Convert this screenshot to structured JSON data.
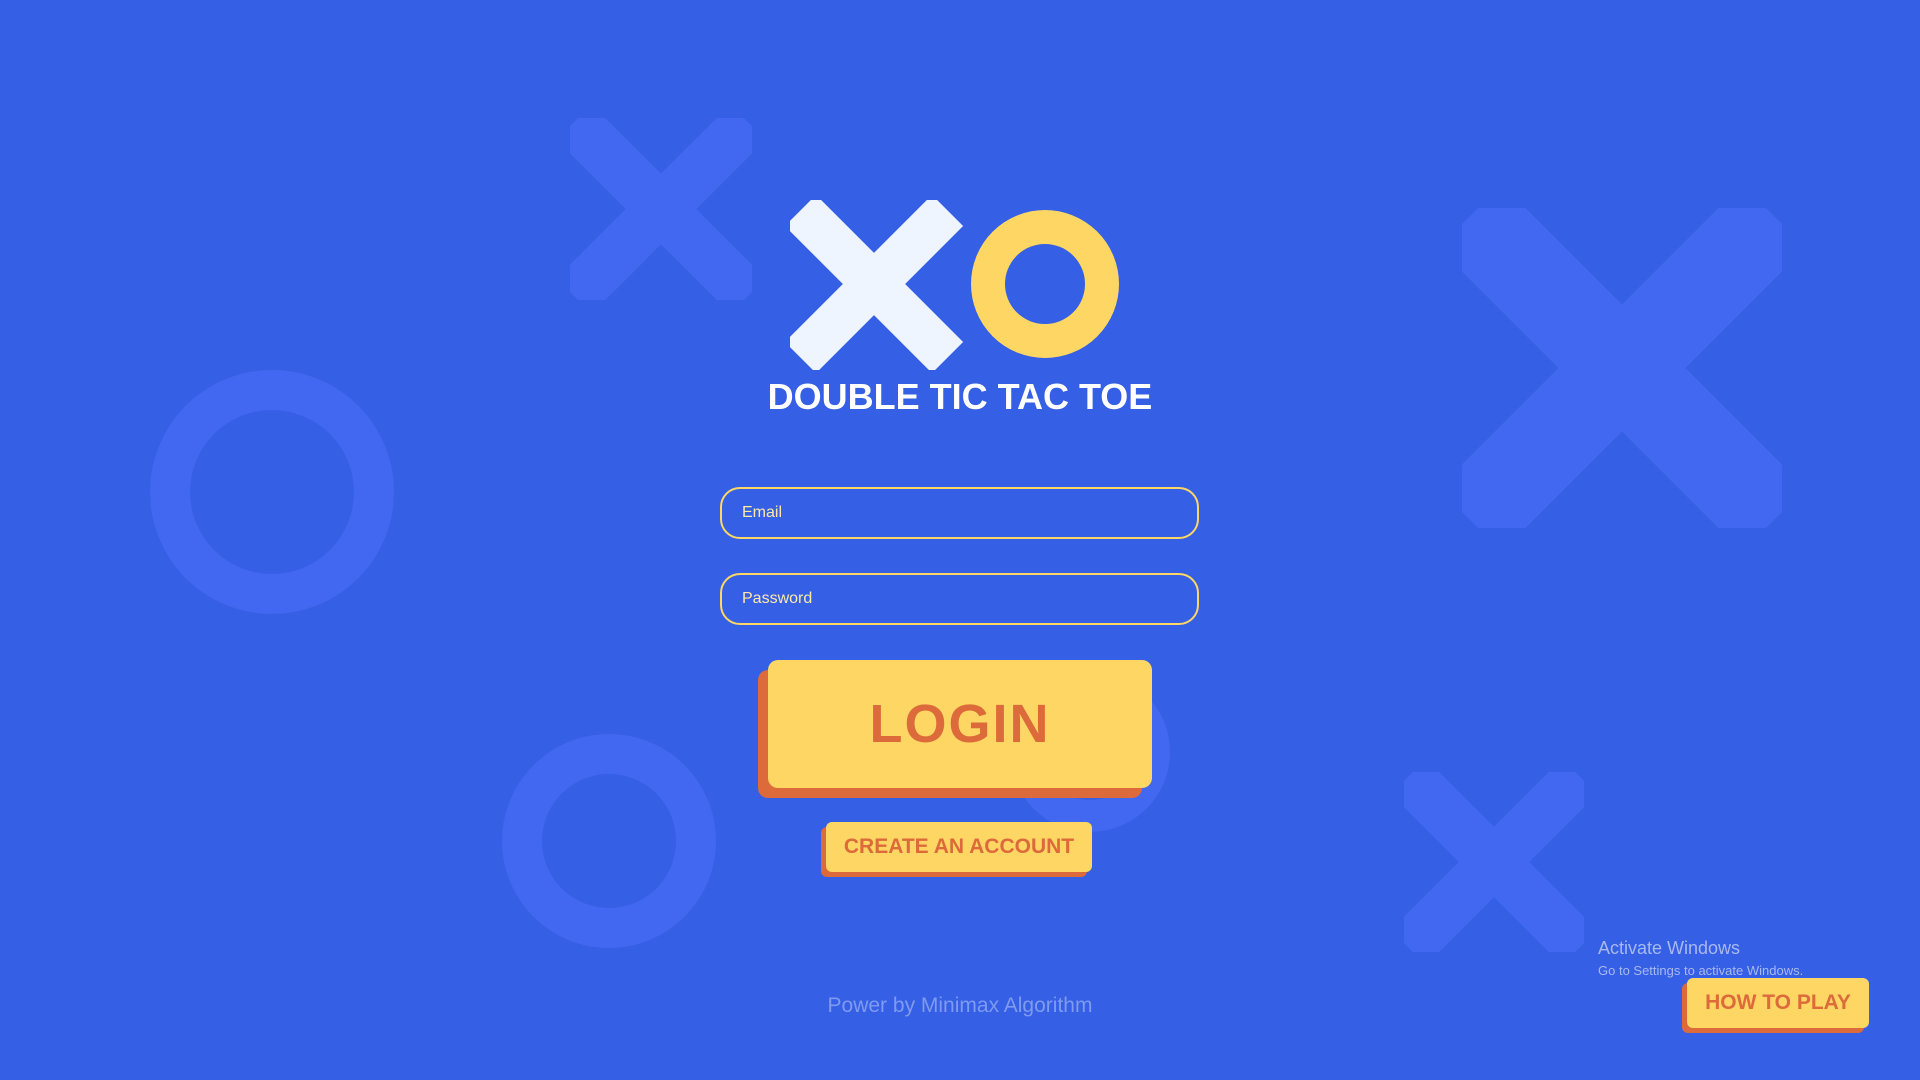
{
  "app": {
    "title": "DOUBLE TIC TAC TOE"
  },
  "login_form": {
    "email_placeholder": "Email",
    "password_placeholder": "Password",
    "login_label": "LOGIN",
    "create_account_label": "CREATE AN ACCOUNT"
  },
  "footer": {
    "text": "Power by Minimax Algorithm"
  },
  "help": {
    "how_to_play_label": "HOW TO PLAY"
  },
  "os_watermark": {
    "title": "Activate Windows",
    "subtitle": "Go to Settings to activate Windows."
  },
  "colors": {
    "background": "#355fe5",
    "decoration": "#4267f0",
    "accent_yellow": "#fdd663",
    "accent_orange": "#dd6a3b",
    "logo_x": "#eef5ff"
  },
  "icons": [
    "logo-x-icon",
    "logo-o-icon",
    "bg-x-icon",
    "bg-o-icon"
  ]
}
